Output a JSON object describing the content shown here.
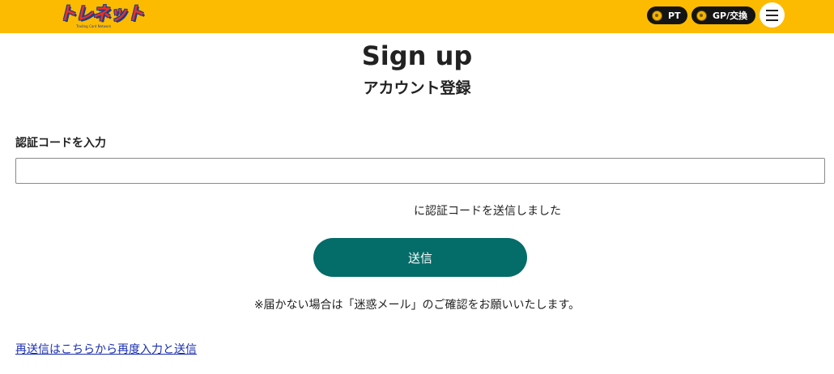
{
  "header": {
    "logo_text": "トレネット",
    "logo_sub": "Trading Card Network",
    "pt_label": "PT",
    "gp_label": "GP/交換",
    "menu_icon": "hamburger-icon",
    "coin_icon": "coin-icon"
  },
  "colors": {
    "header_bg": "#fdbb00",
    "button_bg": "#046c69",
    "link": "#1a2fb0"
  },
  "page": {
    "title": "Sign up",
    "subtitle": "アカウント登録"
  },
  "form": {
    "code_label": "認証コードを入力",
    "code_value": "",
    "code_placeholder": "",
    "sent_message": "に認証コードを送信しました",
    "submit_label": "送信",
    "note": "※届かない場合は「迷惑メール」のご確認をお願いいたします。",
    "resend_link": "再送信はこちらから再度入力と送信"
  }
}
